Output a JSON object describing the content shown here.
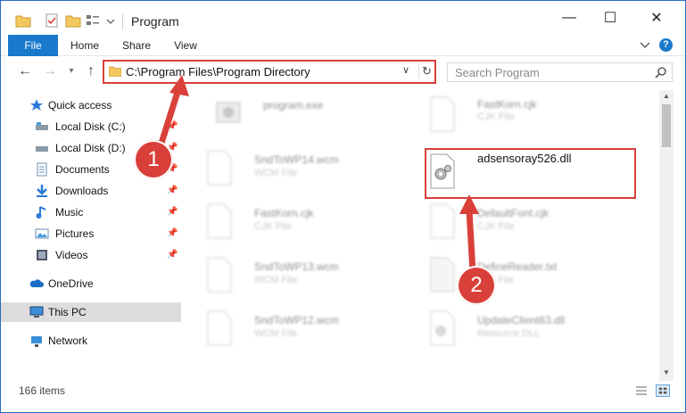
{
  "window": {
    "title": "Program",
    "buttons": {
      "minimize": "—",
      "maximize": "☐",
      "close": "✕"
    }
  },
  "ribbon": {
    "tabs": [
      "File",
      "Home",
      "Share",
      "View"
    ],
    "help": "?"
  },
  "nav": {
    "address": "C:\\Program Files\\Program Directory",
    "search_placeholder": "Search Program"
  },
  "sidebar": {
    "items": [
      {
        "label": "Quick access",
        "icon": "star-icon"
      },
      {
        "label": "Local Disk (C:)",
        "icon": "drive-icon",
        "pinned": true
      },
      {
        "label": "Local Disk (D:)",
        "icon": "drive-icon",
        "pinned": true
      },
      {
        "label": "Documents",
        "icon": "documents-icon",
        "pinned": true
      },
      {
        "label": "Downloads",
        "icon": "download-icon",
        "pinned": true
      },
      {
        "label": "Music",
        "icon": "music-icon",
        "pinned": true
      },
      {
        "label": "Pictures",
        "icon": "pictures-icon",
        "pinned": true
      },
      {
        "label": "Videos",
        "icon": "videos-icon",
        "pinned": true
      },
      {
        "label": "OneDrive",
        "icon": "cloud-icon"
      },
      {
        "label": "This PC",
        "icon": "computer-icon",
        "selected": true
      },
      {
        "label": "Network",
        "icon": "network-icon"
      }
    ]
  },
  "files": {
    "left": [
      {
        "name": "program.exe",
        "type": ""
      },
      {
        "name": "SndToWP14.wcm",
        "type": "WCM File"
      },
      {
        "name": "FastKorn.cjk",
        "type": "CJK File"
      },
      {
        "name": "SndToWP13.wcm",
        "type": "WCM File"
      },
      {
        "name": "SndToWP12.wcm",
        "type": "WCM File"
      }
    ],
    "right": [
      {
        "name": "FastKorn.cjk",
        "type": "CJK File"
      },
      {
        "name": "adsensoray526.dll",
        "type": ""
      },
      {
        "name": "DefaultFont.cjk",
        "type": "CJK File"
      },
      {
        "name": "DefineReader.txt",
        "type": "Text File"
      },
      {
        "name": "UpdateClient63.dll",
        "type": "Resource DLL"
      }
    ]
  },
  "status": {
    "count": "166 items"
  },
  "annotations": {
    "step1": "1",
    "step2": "2"
  },
  "colors": {
    "accent": "#1979ca",
    "annotation": "#d9403a"
  }
}
